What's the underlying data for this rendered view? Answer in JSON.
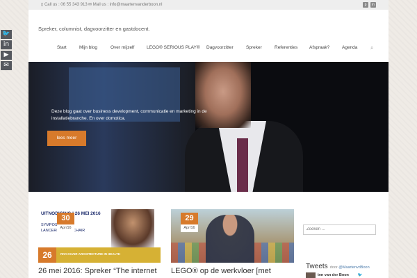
{
  "share": {
    "items": [
      {
        "icon": "twitter-icon",
        "glyph": "🐦"
      },
      {
        "icon": "linkedin-icon",
        "glyph": "in"
      },
      {
        "icon": "youtube-icon",
        "glyph": "▶"
      },
      {
        "icon": "email-icon",
        "glyph": "✉"
      }
    ]
  },
  "topbar": {
    "call": "Call us : 06 55 343 913",
    "mail": "Mail us : info@maartenvanderboon.nl"
  },
  "site": {
    "tagline": "Spreker, columnist, dagvoorzitter en gastdocent."
  },
  "nav": {
    "items": [
      "Start",
      "Mijn blog",
      "Over mijzelf",
      "LEGO® SERIOUS PLAY®",
      "Dagvoorzitter",
      "Spreker",
      "Referenties",
      "Afspraak?",
      "Agenda"
    ]
  },
  "hero": {
    "text": "Deze blog gaat over business development, communicatie en marketing in de installatiebranche. En over domotica.",
    "button": "lees meer"
  },
  "posts": [
    {
      "day": "30",
      "month": "Apr/16",
      "image_line1": "UITNODIGING | 26 MEI 2016",
      "image_line2": "SYMPOSIUM\nLANCERING RIVI-CHAIR",
      "strip_num": "26",
      "strip_caption": "RIVI-CHAIR ARCHITECTURE IN HEALTH",
      "title": "26 mei 2016: Spreker “The internet"
    },
    {
      "day": "29",
      "month": "Apr/16",
      "title": "LEGO® op de werkvloer [met"
    }
  ],
  "sidebar": {
    "search_placeholder": "Zoeken ...",
    "tweets_title": "Tweets",
    "tweets_by": "door",
    "tweets_handle": "@MaartenvdBoon",
    "tweet_author": "ten van der Boon"
  },
  "colors": {
    "accent": "#d77a2b",
    "strip": "#d6b134"
  }
}
